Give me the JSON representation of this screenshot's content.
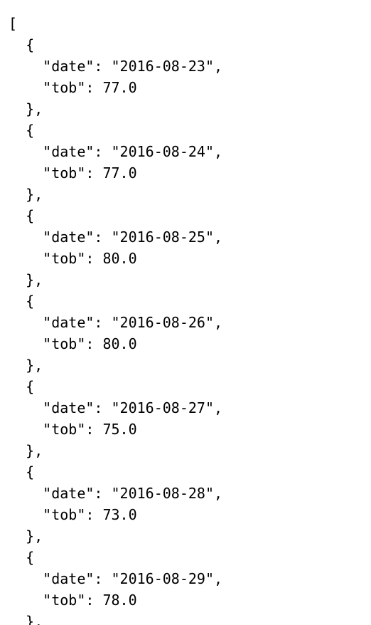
{
  "records": [
    {
      "date": "2016-08-23",
      "tob": "77.0"
    },
    {
      "date": "2016-08-24",
      "tob": "77.0"
    },
    {
      "date": "2016-08-25",
      "tob": "80.0"
    },
    {
      "date": "2016-08-26",
      "tob": "80.0"
    },
    {
      "date": "2016-08-27",
      "tob": "75.0"
    },
    {
      "date": "2016-08-28",
      "tob": "73.0"
    },
    {
      "date": "2016-08-29",
      "tob": "78.0"
    }
  ],
  "colors": {
    "background": "#ffffff",
    "text": "#000000"
  }
}
